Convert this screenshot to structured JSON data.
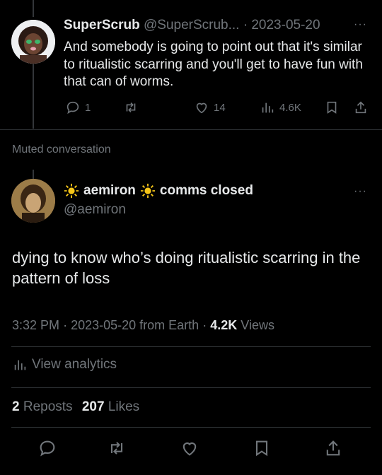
{
  "tweet1": {
    "display_name": "SuperScrub",
    "handle": "@SuperScrub...",
    "dot": "·",
    "date": "2023-05-20",
    "text": "And somebody is going to point out that it's similar to ritualistic scarring and you'll get to have fun with that can of worms.",
    "replies": "1",
    "likes": "14",
    "views": "4.6K"
  },
  "muted_label": "Muted conversation",
  "tweet2": {
    "display_name": "aemiron",
    "name_suffix": "comms closed",
    "handle": "@aemiron",
    "text": "dying to know who’s doing ritualistic scarring in the pattern of loss",
    "time": "3:32 PM",
    "sep": "·",
    "date": "2023-05-20 from Earth",
    "views_count": "4.2K",
    "views_label": "Views",
    "analytics": "View analytics",
    "reposts_count": "2",
    "reposts_label": "Reposts",
    "likes_count": "207",
    "likes_label": "Likes"
  },
  "more_glyph": "···",
  "colors": {
    "background": "#000000",
    "text": "#e7e9ea",
    "muted": "#71767b",
    "divider": "#2f3336",
    "sun": "#f5c518"
  }
}
